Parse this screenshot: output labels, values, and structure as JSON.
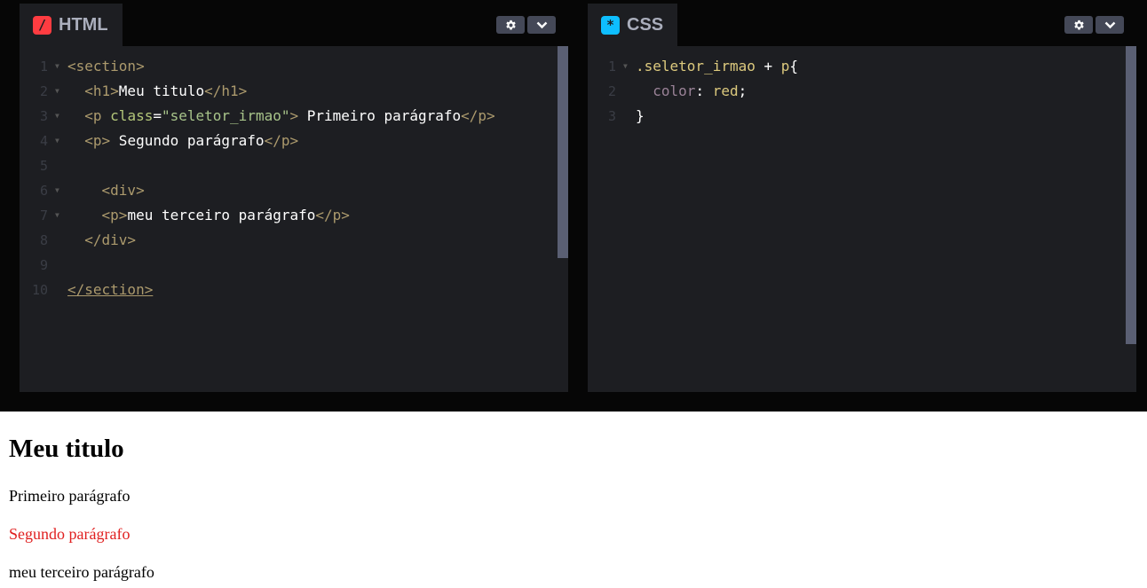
{
  "panels": {
    "html": {
      "title": "HTML",
      "icon": "/"
    },
    "css": {
      "title": "CSS",
      "icon": "*"
    }
  },
  "html_code": [
    "<section>",
    "  <h1>Meu titulo</h1>",
    "  <p class=\"seletor_irmao\"> Primeiro parágrafo</p>",
    "  <p> Segundo parágrafo</p>",
    "",
    "  <div>",
    "    <p>meu terceiro parágrafo</p>",
    "  </div>",
    "",
    "</section>"
  ],
  "css_code": [
    ".seletor_irmao + p{",
    "  color: red;",
    "}"
  ],
  "preview": {
    "heading": "Meu titulo",
    "p1": "Primeiro parágrafo",
    "p2": "Segundo parágrafo",
    "p3": "meu terceiro parágrafo"
  },
  "colors": {
    "red_text": "#e02020",
    "editor_bg": "#1d1e22",
    "chrome_bg": "#060606"
  }
}
